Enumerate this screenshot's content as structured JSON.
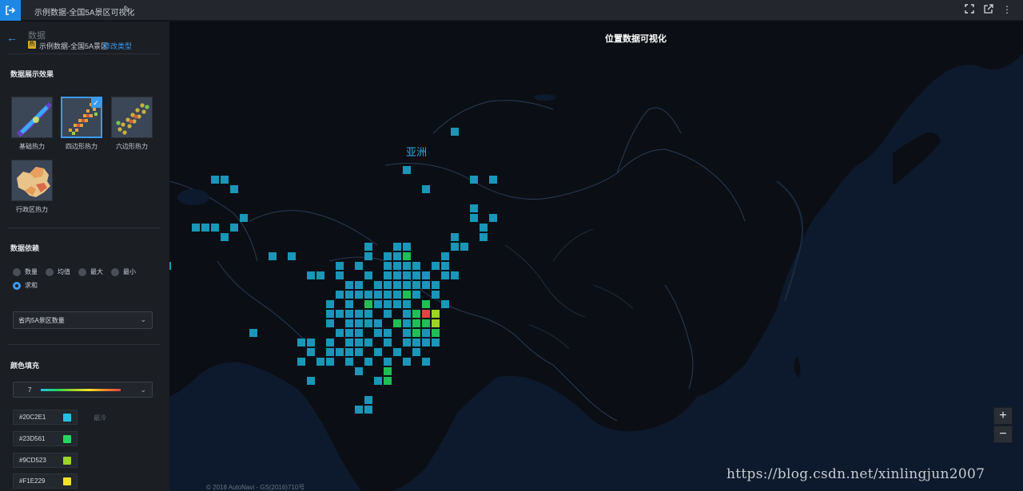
{
  "topbar": {
    "exit_icon": "exit-icon",
    "title": "示例数据-全国5A景区可视化",
    "edit_icon": "pencil-icon",
    "right_icons": [
      "fullscreen-icon",
      "external-link-icon",
      "more-vertical-icon"
    ]
  },
  "sidebar": {
    "back_icon": "arrow-left-icon",
    "heading": "数据",
    "dataset_badge": "热",
    "dataset_name": "示例数据-全国5A景区",
    "change_type": "修改类型",
    "effect": {
      "title": "数据展示效果",
      "options": [
        {
          "label": "基础热力",
          "selected": false
        },
        {
          "label": "四边形热力",
          "selected": true
        },
        {
          "label": "六边形热力",
          "selected": false
        },
        {
          "label": "行政区热力",
          "selected": false
        }
      ]
    },
    "basis": {
      "title": "数据依赖",
      "options": [
        {
          "label": "数量",
          "selected": false
        },
        {
          "label": "均值",
          "selected": false
        },
        {
          "label": "最大",
          "selected": false
        },
        {
          "label": "最小",
          "selected": false
        },
        {
          "label": "求和",
          "selected": true
        }
      ],
      "field_select": "省内5A景区数量"
    },
    "color": {
      "title": "颜色填充",
      "levels": "7",
      "scale": [
        {
          "hex": "#20C2E1",
          "label": "最冷"
        },
        {
          "hex": "#23D561",
          "label": ""
        },
        {
          "hex": "#9CD523",
          "label": ""
        },
        {
          "hex": "#F1E229",
          "label": ""
        }
      ]
    }
  },
  "map": {
    "title": "位置数据可视化",
    "continent_label": "亚洲",
    "zoom_in": "+",
    "zoom_out": "−",
    "copyright": "© 2018 AutoNavi - GS(2016)710号",
    "watermark": "https://blog.csdn.net/xinlingjun2007",
    "colors": {
      "cold": "#1a96b8",
      "green": "#1fbf55",
      "yellowgreen": "#9cd523",
      "yellow": "#f1e229",
      "red": "#e0444a"
    },
    "cells": [
      {
        "col": 49,
        "row": 11,
        "level": 0
      },
      {
        "col": 44,
        "row": 15,
        "level": 0
      },
      {
        "col": 24,
        "row": 16,
        "level": 0
      },
      {
        "col": 25,
        "row": 16,
        "level": 0
      },
      {
        "col": 51,
        "row": 16,
        "level": 0
      },
      {
        "col": 53,
        "row": 16,
        "level": 0
      },
      {
        "col": 26,
        "row": 17,
        "level": 0
      },
      {
        "col": 46,
        "row": 17,
        "level": 0
      },
      {
        "col": 51,
        "row": 19,
        "level": 0
      },
      {
        "col": 27,
        "row": 20,
        "level": 0
      },
      {
        "col": 51,
        "row": 20,
        "level": 0
      },
      {
        "col": 53,
        "row": 20,
        "level": 0
      },
      {
        "col": 22,
        "row": 21,
        "level": 0
      },
      {
        "col": 23,
        "row": 21,
        "level": 0
      },
      {
        "col": 24,
        "row": 21,
        "level": 0
      },
      {
        "col": 26,
        "row": 21,
        "level": 0
      },
      {
        "col": 52,
        "row": 21,
        "level": 0
      },
      {
        "col": 25,
        "row": 22,
        "level": 0
      },
      {
        "col": 49,
        "row": 22,
        "level": 0
      },
      {
        "col": 52,
        "row": 22,
        "level": 0
      },
      {
        "col": 40,
        "row": 23,
        "level": 0
      },
      {
        "col": 43,
        "row": 23,
        "level": 0
      },
      {
        "col": 44,
        "row": 23,
        "level": 0
      },
      {
        "col": 49,
        "row": 23,
        "level": 0
      },
      {
        "col": 50,
        "row": 23,
        "level": 0
      },
      {
        "col": 18,
        "row": 24,
        "level": 0
      },
      {
        "col": 30,
        "row": 24,
        "level": 0
      },
      {
        "col": 32,
        "row": 24,
        "level": 0
      },
      {
        "col": 40,
        "row": 24,
        "level": 0
      },
      {
        "col": 42,
        "row": 24,
        "level": 0
      },
      {
        "col": 43,
        "row": 24,
        "level": 0
      },
      {
        "col": 44,
        "row": 24,
        "level": 1
      },
      {
        "col": 48,
        "row": 24,
        "level": 0
      },
      {
        "col": 19,
        "row": 25,
        "level": 0
      },
      {
        "col": 37,
        "row": 25,
        "level": 0
      },
      {
        "col": 39,
        "row": 25,
        "level": 0
      },
      {
        "col": 42,
        "row": 25,
        "level": 0
      },
      {
        "col": 43,
        "row": 25,
        "level": 0
      },
      {
        "col": 44,
        "row": 25,
        "level": 0
      },
      {
        "col": 45,
        "row": 25,
        "level": 0
      },
      {
        "col": 47,
        "row": 25,
        "level": 0
      },
      {
        "col": 48,
        "row": 25,
        "level": 0
      },
      {
        "col": 34,
        "row": 26,
        "level": 0
      },
      {
        "col": 35,
        "row": 26,
        "level": 0
      },
      {
        "col": 37,
        "row": 26,
        "level": 0
      },
      {
        "col": 40,
        "row": 26,
        "level": 0
      },
      {
        "col": 42,
        "row": 26,
        "level": 0
      },
      {
        "col": 43,
        "row": 26,
        "level": 0
      },
      {
        "col": 44,
        "row": 26,
        "level": 0
      },
      {
        "col": 45,
        "row": 26,
        "level": 0
      },
      {
        "col": 46,
        "row": 26,
        "level": 0
      },
      {
        "col": 48,
        "row": 26,
        "level": 0
      },
      {
        "col": 49,
        "row": 26,
        "level": 0
      },
      {
        "col": 38,
        "row": 27,
        "level": 0
      },
      {
        "col": 39,
        "row": 27,
        "level": 0
      },
      {
        "col": 41,
        "row": 27,
        "level": 0
      },
      {
        "col": 42,
        "row": 27,
        "level": 0
      },
      {
        "col": 43,
        "row": 27,
        "level": 0
      },
      {
        "col": 44,
        "row": 27,
        "level": 0
      },
      {
        "col": 45,
        "row": 27,
        "level": 0
      },
      {
        "col": 46,
        "row": 27,
        "level": 0
      },
      {
        "col": 47,
        "row": 27,
        "level": 0
      },
      {
        "col": 37,
        "row": 28,
        "level": 0
      },
      {
        "col": 38,
        "row": 28,
        "level": 0
      },
      {
        "col": 39,
        "row": 28,
        "level": 0
      },
      {
        "col": 40,
        "row": 28,
        "level": 0
      },
      {
        "col": 41,
        "row": 28,
        "level": 0
      },
      {
        "col": 42,
        "row": 28,
        "level": 0
      },
      {
        "col": 43,
        "row": 28,
        "level": 0
      },
      {
        "col": 44,
        "row": 28,
        "level": 1
      },
      {
        "col": 45,
        "row": 28,
        "level": 0
      },
      {
        "col": 47,
        "row": 28,
        "level": 0
      },
      {
        "col": 36,
        "row": 29,
        "level": 0
      },
      {
        "col": 38,
        "row": 29,
        "level": 0
      },
      {
        "col": 40,
        "row": 29,
        "level": 1
      },
      {
        "col": 41,
        "row": 29,
        "level": 0
      },
      {
        "col": 42,
        "row": 29,
        "level": 0
      },
      {
        "col": 43,
        "row": 29,
        "level": 0
      },
      {
        "col": 44,
        "row": 29,
        "level": 0
      },
      {
        "col": 46,
        "row": 29,
        "level": 1
      },
      {
        "col": 48,
        "row": 29,
        "level": 0
      },
      {
        "col": 36,
        "row": 30,
        "level": 0
      },
      {
        "col": 37,
        "row": 30,
        "level": 0
      },
      {
        "col": 38,
        "row": 30,
        "level": 0
      },
      {
        "col": 39,
        "row": 30,
        "level": 0
      },
      {
        "col": 40,
        "row": 30,
        "level": 0
      },
      {
        "col": 42,
        "row": 30,
        "level": 0
      },
      {
        "col": 44,
        "row": 30,
        "level": 0
      },
      {
        "col": 45,
        "row": 30,
        "level": 1
      },
      {
        "col": 46,
        "row": 30,
        "level": 4
      },
      {
        "col": 47,
        "row": 30,
        "level": 2
      },
      {
        "col": 36,
        "row": 31,
        "level": 0
      },
      {
        "col": 38,
        "row": 31,
        "level": 0
      },
      {
        "col": 39,
        "row": 31,
        "level": 0
      },
      {
        "col": 40,
        "row": 31,
        "level": 0
      },
      {
        "col": 41,
        "row": 31,
        "level": 0
      },
      {
        "col": 43,
        "row": 31,
        "level": 1
      },
      {
        "col": 44,
        "row": 31,
        "level": 0
      },
      {
        "col": 45,
        "row": 31,
        "level": 1
      },
      {
        "col": 46,
        "row": 31,
        "level": 1
      },
      {
        "col": 47,
        "row": 31,
        "level": 2
      },
      {
        "col": 28,
        "row": 32,
        "level": 0
      },
      {
        "col": 37,
        "row": 32,
        "level": 0
      },
      {
        "col": 38,
        "row": 32,
        "level": 0
      },
      {
        "col": 39,
        "row": 32,
        "level": 0
      },
      {
        "col": 41,
        "row": 32,
        "level": 0
      },
      {
        "col": 42,
        "row": 32,
        "level": 0
      },
      {
        "col": 44,
        "row": 32,
        "level": 0
      },
      {
        "col": 45,
        "row": 32,
        "level": 1
      },
      {
        "col": 46,
        "row": 32,
        "level": 0
      },
      {
        "col": 47,
        "row": 32,
        "level": 1
      },
      {
        "col": 33,
        "row": 33,
        "level": 0
      },
      {
        "col": 34,
        "row": 33,
        "level": 0
      },
      {
        "col": 36,
        "row": 33,
        "level": 0
      },
      {
        "col": 38,
        "row": 33,
        "level": 0
      },
      {
        "col": 39,
        "row": 33,
        "level": 0
      },
      {
        "col": 40,
        "row": 33,
        "level": 0
      },
      {
        "col": 42,
        "row": 33,
        "level": 0
      },
      {
        "col": 44,
        "row": 33,
        "level": 0
      },
      {
        "col": 45,
        "row": 33,
        "level": 0
      },
      {
        "col": 46,
        "row": 33,
        "level": 0
      },
      {
        "col": 47,
        "row": 33,
        "level": 0
      },
      {
        "col": 34,
        "row": 34,
        "level": 0
      },
      {
        "col": 36,
        "row": 34,
        "level": 0
      },
      {
        "col": 37,
        "row": 34,
        "level": 0
      },
      {
        "col": 38,
        "row": 34,
        "level": 0
      },
      {
        "col": 39,
        "row": 34,
        "level": 0
      },
      {
        "col": 41,
        "row": 34,
        "level": 0
      },
      {
        "col": 43,
        "row": 34,
        "level": 0
      },
      {
        "col": 45,
        "row": 34,
        "level": 0
      },
      {
        "col": 33,
        "row": 35,
        "level": 0
      },
      {
        "col": 35,
        "row": 35,
        "level": 0
      },
      {
        "col": 36,
        "row": 35,
        "level": 0
      },
      {
        "col": 38,
        "row": 35,
        "level": 0
      },
      {
        "col": 40,
        "row": 35,
        "level": 0
      },
      {
        "col": 42,
        "row": 35,
        "level": 0
      },
      {
        "col": 44,
        "row": 35,
        "level": 0
      },
      {
        "col": 46,
        "row": 35,
        "level": 0
      },
      {
        "col": 39,
        "row": 36,
        "level": 0
      },
      {
        "col": 42,
        "row": 36,
        "level": 1
      },
      {
        "col": 34,
        "row": 37,
        "level": 0
      },
      {
        "col": 41,
        "row": 37,
        "level": 0
      },
      {
        "col": 42,
        "row": 37,
        "level": 1
      },
      {
        "col": 40,
        "row": 39,
        "level": 0
      },
      {
        "col": 39,
        "row": 40,
        "level": 0
      },
      {
        "col": 40,
        "row": 40,
        "level": 0
      }
    ]
  }
}
